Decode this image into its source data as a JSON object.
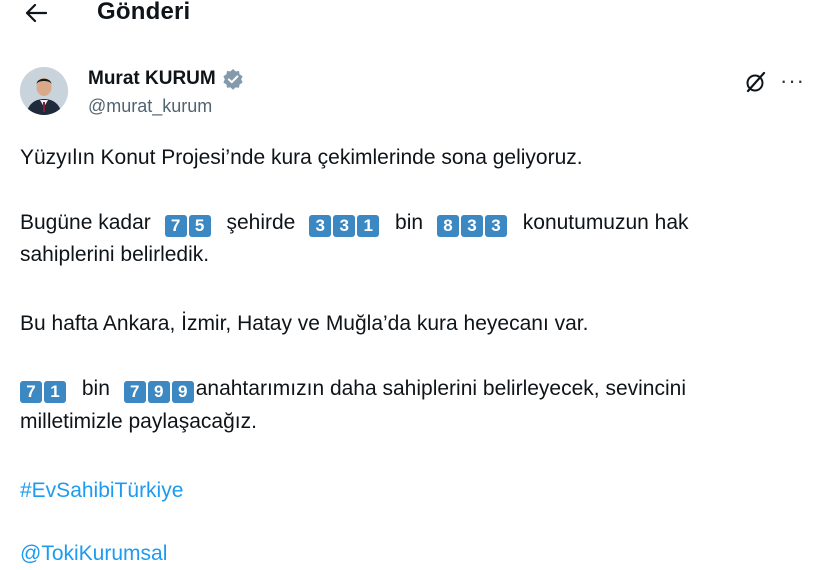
{
  "header": {
    "title": "Gönderi"
  },
  "author": {
    "name": "Murat KURUM",
    "handle": "@murat_kurum"
  },
  "post": {
    "line1": "Yüzyılın Konut Projesi’nde kura çekimlerinde sona geliyoruz.",
    "p2_a": "Bugüne kadar",
    "num_cities": [
      "7",
      "5"
    ],
    "p2_b": "şehirde",
    "num_a": [
      "3",
      "3",
      "1"
    ],
    "p2_c": "bin",
    "num_b": [
      "8",
      "3",
      "3"
    ],
    "p2_d": "konutumuzun hak",
    "p2_line2": "sahiplerini belirledik.",
    "line3": "Bu hafta Ankara, İzmir, Hatay ve Muğla’da kura heyecanı var.",
    "num_c": [
      "7",
      "1"
    ],
    "p4_a": "bin",
    "num_d": [
      "7",
      "9",
      "9"
    ],
    "p4_b": "anahtarımızın daha sahiplerini belirleyecek, sevincini",
    "p4_line2": "milletimizle paylaşacağız.",
    "hashtag": "#EvSahibiTürkiye",
    "mention": "@TokiKurumsal"
  },
  "colors": {
    "accent": "#1d9bf0",
    "keycap": "#3b88c3"
  },
  "icons": {
    "back": "arrow-left-icon",
    "verified": "verified-badge-icon",
    "grok": "grok-icon",
    "more": "more-dots-icon"
  }
}
